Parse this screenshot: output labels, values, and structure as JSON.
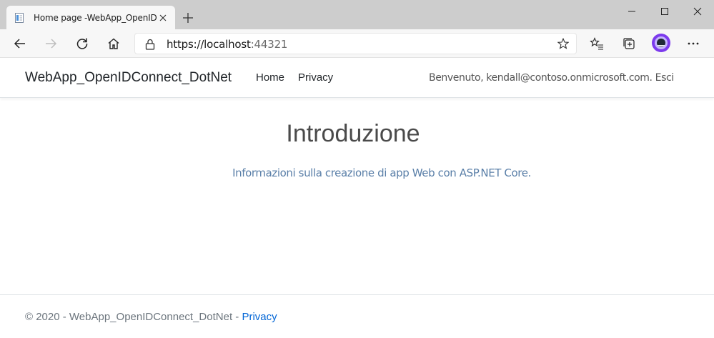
{
  "browser": {
    "tab": {
      "title": "Home page -WebApp_OpenIDC",
      "favicon": "page-icon",
      "close": "close-icon"
    },
    "new_tab": "plus-icon",
    "window_controls": [
      "minimize-icon",
      "maximize-icon",
      "close-icon"
    ],
    "toolbar": {
      "back": "arrow-left-icon",
      "forward": "arrow-right-icon",
      "refresh": "refresh-icon",
      "home": "home-icon",
      "address": {
        "host": "https://localhost",
        "port": ":44321",
        "lock": "lock-icon",
        "favorite": "star-icon"
      },
      "right_icons": [
        "favorites-list-icon",
        "collections-icon",
        "profile-avatar",
        "more-icon"
      ]
    },
    "colors": {
      "tabstrip": "#cdcdcd",
      "toolbar": "#f7f7f7",
      "avatar": "#7c3aed"
    }
  },
  "page": {
    "navbar": {
      "brand": "WebApp_OpenIDConnect_DotNet",
      "links": [
        "Home",
        "Privacy"
      ],
      "welcome": "Benvenuto, kendall@contoso.onmicrosoft.com.",
      "signout": "Esci"
    },
    "main": {
      "title": "Introduzione",
      "lead": "Informazioni sulla creazione di app Web con ASP.NET Core."
    },
    "footer": {
      "text": "© 2020 - WebApp_OpenIDConnect_DotNet - ",
      "link": "Privacy"
    },
    "colors": {
      "link": "#0366d6",
      "lead": "#5a7fa8",
      "footer_text": "#6c757d"
    }
  }
}
